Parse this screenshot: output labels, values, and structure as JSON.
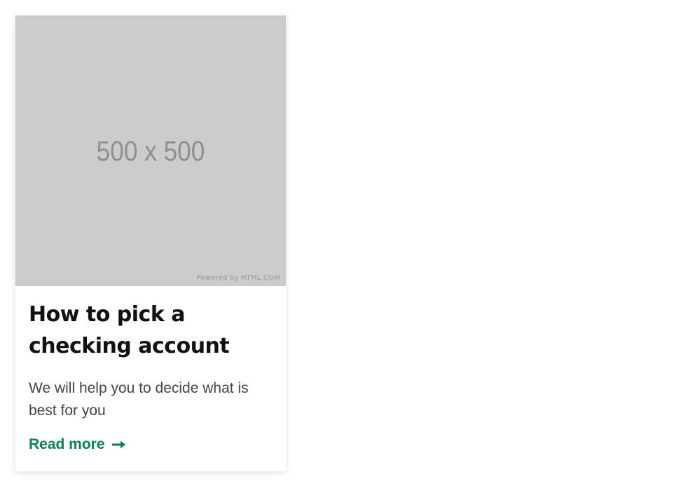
{
  "card": {
    "image": {
      "placeholder_text": "500 x 500",
      "credit_text": "Powered by HTML.COM"
    },
    "title": "How to pick a checking account",
    "description": "We will help you to decide what is best for you",
    "link_label": "Read more",
    "link_icon": "arrow-right-icon"
  },
  "colors": {
    "link": "#0a8056",
    "image_bg": "#cccccc",
    "title": "#111111",
    "description": "#444444"
  }
}
